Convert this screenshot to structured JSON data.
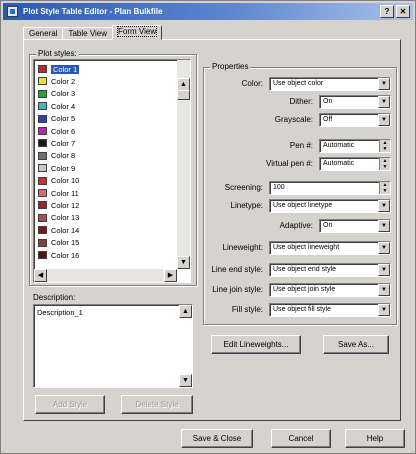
{
  "window": {
    "title": "Plot Style Table Editor - Plan Bulkfile"
  },
  "tabs": [
    {
      "label": "General"
    },
    {
      "label": "Table View"
    },
    {
      "label": "Form View"
    }
  ],
  "plot_styles": {
    "group_label": "Plot styles:",
    "items": [
      {
        "label": "Color 1",
        "color": "#d22020"
      },
      {
        "label": "Color 2",
        "color": "#e6e12a"
      },
      {
        "label": "Color 3",
        "color": "#2aa13a"
      },
      {
        "label": "Color 4",
        "color": "#3fb7c7"
      },
      {
        "label": "Color 5",
        "color": "#2a3fb8"
      },
      {
        "label": "Color 6",
        "color": "#b52ab0"
      },
      {
        "label": "Color 7",
        "color": "#1a1a1a"
      },
      {
        "label": "Color 8",
        "color": "#707070"
      },
      {
        "label": "Color 9",
        "color": "#c8c8c8"
      },
      {
        "label": "Color 10",
        "color": "#d82a2a"
      },
      {
        "label": "Color 11",
        "color": "#d86a6a"
      },
      {
        "label": "Color 12",
        "color": "#a82020"
      },
      {
        "label": "Color 13",
        "color": "#a85050"
      },
      {
        "label": "Color 14",
        "color": "#801818"
      },
      {
        "label": "Color 15",
        "color": "#804040"
      },
      {
        "label": "Color 16",
        "color": "#5a1010"
      }
    ]
  },
  "description": {
    "label": "Description:",
    "value": "Description_1"
  },
  "buttons": {
    "add_style": "Add Style",
    "delete_style": "Delete Style",
    "edit_lineweights": "Edit Lineweights...",
    "save_as": "Save As...",
    "save_close": "Save & Close",
    "cancel": "Cancel",
    "help": "Help"
  },
  "properties": {
    "group_label": "Properties",
    "color": {
      "label": "Color:",
      "value": "Use object color"
    },
    "dither": {
      "label": "Dither:",
      "value": "On"
    },
    "grayscale": {
      "label": "Grayscale:",
      "value": "Off"
    },
    "pen": {
      "label": "Pen #:",
      "value": "Automatic"
    },
    "virtual_pen": {
      "label": "Virtual pen #:",
      "value": "Automatic"
    },
    "screening": {
      "label": "Screening:",
      "value": "100"
    },
    "linetype": {
      "label": "Linetype:",
      "value": "Use object linetype"
    },
    "adaptive": {
      "label": "Adaptive:",
      "value": "On"
    },
    "lineweight": {
      "label": "Lineweight:",
      "value": "Use object lineweight"
    },
    "line_end_style": {
      "label": "Line end style:",
      "value": "Use object end style"
    },
    "line_join_style": {
      "label": "Line join style:",
      "value": "Use object join style"
    },
    "fill_style": {
      "label": "Fill style:",
      "value": "Use object fill style"
    }
  }
}
